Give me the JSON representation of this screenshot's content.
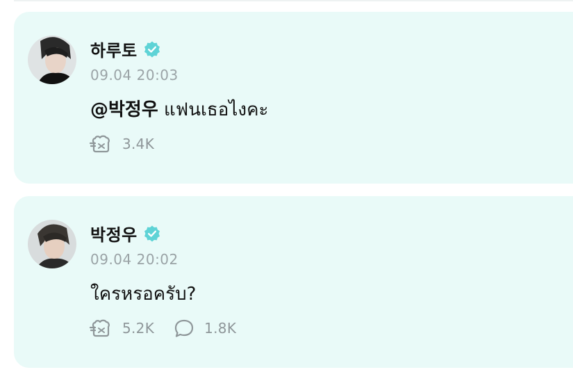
{
  "posts": [
    {
      "author": "하루토",
      "verified_icon": "verified-badge-icon",
      "time": "09.04 20:03",
      "mention": "@박정우",
      "text": " แฟนเธอไงคะ",
      "likes": "3.4K"
    },
    {
      "author": "박정우",
      "verified_icon": "verified-badge-icon",
      "time": "09.04 20:02",
      "text": "ใครหรอครับ?",
      "likes": "5.2K",
      "comments": "1.8K"
    }
  ],
  "colors": {
    "card_background": "#e9faf8",
    "verified_badge": "#5ed3d6",
    "muted_text": "#9aa3a6"
  }
}
